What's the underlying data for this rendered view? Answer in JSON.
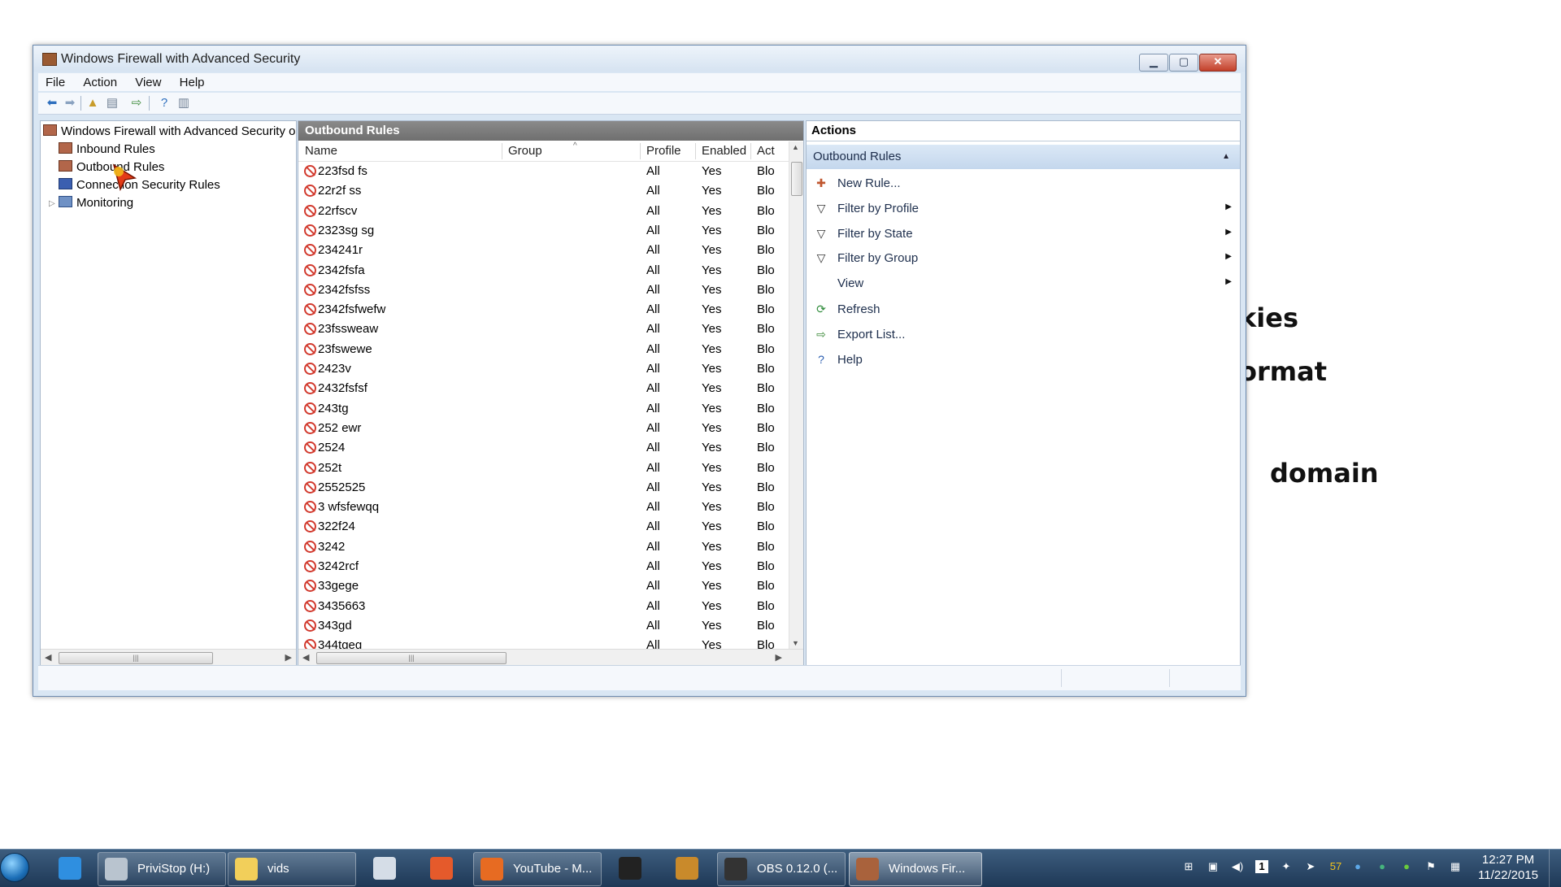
{
  "background": {
    "fragments": [
      "kies",
      "ormat",
      "domain"
    ]
  },
  "window": {
    "title": "Windows Firewall with Advanced Security",
    "controls": {
      "minimize": "▁",
      "maximize": "▢",
      "close": "✕"
    }
  },
  "menu": [
    "File",
    "Action",
    "View",
    "Help"
  ],
  "tree": {
    "root": "Windows Firewall with Advanced Security o",
    "items": [
      "Inbound Rules",
      "Outbound Rules",
      "Connection Security Rules",
      "Monitoring"
    ]
  },
  "center": {
    "header": "Outbound Rules",
    "columns": [
      "Name",
      "Group",
      "Profile",
      "Enabled",
      "Act"
    ],
    "rows": [
      {
        "name": "223fsd fs",
        "group": "",
        "profile": "All",
        "enabled": "Yes",
        "action": "Blo"
      },
      {
        "name": "22r2f ss",
        "group": "",
        "profile": "All",
        "enabled": "Yes",
        "action": "Blo"
      },
      {
        "name": "22rfscv",
        "group": "",
        "profile": "All",
        "enabled": "Yes",
        "action": "Blo"
      },
      {
        "name": "2323sg  sg",
        "group": "",
        "profile": "All",
        "enabled": "Yes",
        "action": "Blo"
      },
      {
        "name": "234241r",
        "group": "",
        "profile": "All",
        "enabled": "Yes",
        "action": "Blo"
      },
      {
        "name": "2342fsfa",
        "group": "",
        "profile": "All",
        "enabled": "Yes",
        "action": "Blo"
      },
      {
        "name": "2342fsfss",
        "group": "",
        "profile": "All",
        "enabled": "Yes",
        "action": "Blo"
      },
      {
        "name": "2342fsfwefw",
        "group": "",
        "profile": "All",
        "enabled": "Yes",
        "action": "Blo"
      },
      {
        "name": "23fssweaw",
        "group": "",
        "profile": "All",
        "enabled": "Yes",
        "action": "Blo"
      },
      {
        "name": "23fswewe",
        "group": "",
        "profile": "All",
        "enabled": "Yes",
        "action": "Blo"
      },
      {
        "name": "2423v",
        "group": "",
        "profile": "All",
        "enabled": "Yes",
        "action": "Blo"
      },
      {
        "name": "2432fsfsf",
        "group": "",
        "profile": "All",
        "enabled": "Yes",
        "action": "Blo"
      },
      {
        "name": "243tg",
        "group": "",
        "profile": "All",
        "enabled": "Yes",
        "action": "Blo"
      },
      {
        "name": "252 ewr",
        "group": "",
        "profile": "All",
        "enabled": "Yes",
        "action": "Blo"
      },
      {
        "name": "2524",
        "group": "",
        "profile": "All",
        "enabled": "Yes",
        "action": "Blo"
      },
      {
        "name": "252t",
        "group": "",
        "profile": "All",
        "enabled": "Yes",
        "action": "Blo"
      },
      {
        "name": "2552525",
        "group": "",
        "profile": "All",
        "enabled": "Yes",
        "action": "Blo"
      },
      {
        "name": "3 wfsfewqq",
        "group": "",
        "profile": "All",
        "enabled": "Yes",
        "action": "Blo"
      },
      {
        "name": "322f24",
        "group": "",
        "profile": "All",
        "enabled": "Yes",
        "action": "Blo"
      },
      {
        "name": "3242",
        "group": "",
        "profile": "All",
        "enabled": "Yes",
        "action": "Blo"
      },
      {
        "name": "3242rcf",
        "group": "",
        "profile": "All",
        "enabled": "Yes",
        "action": "Blo"
      },
      {
        "name": "33gege",
        "group": "",
        "profile": "All",
        "enabled": "Yes",
        "action": "Blo"
      },
      {
        "name": "3435663",
        "group": "",
        "profile": "All",
        "enabled": "Yes",
        "action": "Blo"
      },
      {
        "name": "343gd",
        "group": "",
        "profile": "All",
        "enabled": "Yes",
        "action": "Blo"
      },
      {
        "name": "344tgeg",
        "group": "",
        "profile": "All",
        "enabled": "Yes",
        "action": "Blo"
      }
    ]
  },
  "actions": {
    "header": "Actions",
    "group": "Outbound Rules",
    "items": [
      {
        "label": "New Rule...",
        "icon": "new-rule-icon",
        "glyph": "✚",
        "color": "#c0572f",
        "submenu": false
      },
      {
        "label": "Filter by Profile",
        "icon": "filter-icon",
        "glyph": "▽",
        "color": "#333333",
        "submenu": true
      },
      {
        "label": "Filter by State",
        "icon": "filter-icon",
        "glyph": "▽",
        "color": "#333333",
        "submenu": true
      },
      {
        "label": "Filter by Group",
        "icon": "filter-icon",
        "glyph": "▽",
        "color": "#333333",
        "submenu": true
      },
      {
        "label": "View",
        "icon": "",
        "glyph": "",
        "color": "#333333",
        "submenu": true
      },
      {
        "label": "Refresh",
        "icon": "refresh-icon",
        "glyph": "⟳",
        "color": "#2e8b3a",
        "submenu": false
      },
      {
        "label": "Export List...",
        "icon": "export-icon",
        "glyph": "⇨",
        "color": "#3d8b3a",
        "submenu": false
      },
      {
        "label": "Help",
        "icon": "help-icon",
        "glyph": "?",
        "color": "#2a5db0",
        "submenu": false
      }
    ]
  },
  "taskbar": {
    "apps": [
      {
        "label": "",
        "icon": "internet-explorer-icon",
        "color": "#2f8fe0"
      },
      {
        "label": "PriviStop (H:)",
        "icon": "drive-icon",
        "color": "#b9c4cf"
      },
      {
        "label": "vids",
        "icon": "folder-icon",
        "color": "#f2cf5a"
      },
      {
        "label": "",
        "icon": "snipping-tool-icon",
        "color": "#d5dde7"
      },
      {
        "label": "",
        "icon": "power-icon",
        "color": "#e55a2b"
      },
      {
        "label": "YouTube - M...",
        "icon": "firefox-icon",
        "color": "#e76b22"
      },
      {
        "label": "",
        "icon": "udk-icon",
        "color": "#222222"
      },
      {
        "label": "",
        "icon": "app-icon",
        "color": "#c98a2b"
      },
      {
        "label": "OBS 0.12.0 (...",
        "icon": "obs-icon",
        "color": "#333333"
      },
      {
        "label": "Windows Fir...",
        "icon": "firewall-icon",
        "color": "#a9623c"
      }
    ],
    "tray_number": "57",
    "time": "12:27 PM",
    "date": "11/22/2015"
  }
}
